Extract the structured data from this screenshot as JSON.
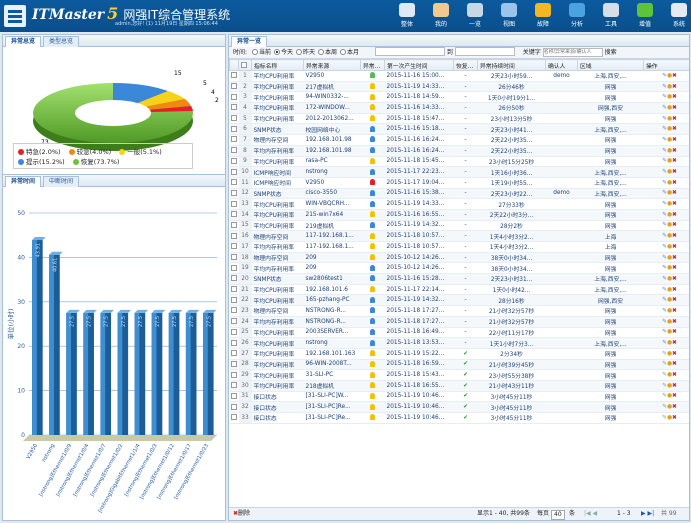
{
  "header": {
    "brand_en": "ITMaster",
    "brand_num": "5",
    "brand_cn": "网强IT综合管理系统",
    "user_line": "admin,您好! (1) 11月19日 星期四 15:06:44"
  },
  "nav": [
    {
      "label": "整体",
      "icon": "monitor-icon",
      "color": "#dfe9f4"
    },
    {
      "label": "我的",
      "icon": "user-icon",
      "color": "#f0c890"
    },
    {
      "label": "一览",
      "icon": "screen-icon",
      "color": "#c8d6e6"
    },
    {
      "label": "视图",
      "icon": "grid-icon",
      "color": "#9cc4ea"
    },
    {
      "label": "故障",
      "icon": "warning-icon",
      "color": "#f2b722"
    },
    {
      "label": "分析",
      "icon": "pie-icon",
      "color": "#4aa3e0"
    },
    {
      "label": "工具",
      "icon": "tools-icon",
      "color": "#d8dee6"
    },
    {
      "label": "增值",
      "icon": "plus-icon",
      "color": "#5cc33a"
    },
    {
      "label": "系统",
      "icon": "gear-icon",
      "color": "#e6eaf0"
    }
  ],
  "left_top": {
    "tabs": [
      "异常总览",
      "类型总览"
    ],
    "pie": {
      "labels": [
        "15",
        "5",
        "4",
        "2",
        "73"
      ],
      "legend": [
        {
          "label": "特急(2.0%)",
          "color": "#e3202a"
        },
        {
          "label": "较急(4.0%)",
          "color": "#ee8a12"
        },
        {
          "label": "一般(5.1%)",
          "color": "#f7d21a"
        },
        {
          "label": "提示(15.2%)",
          "color": "#3b87d9"
        },
        {
          "label": "恢复(73.7%)",
          "color": "#6ec13a"
        }
      ]
    }
  },
  "left_bottom": {
    "tabs": [
      "异常时间",
      "中断时间"
    ],
    "chart_data": {
      "type": "bar",
      "ylabel": "单位(小时)",
      "ylim": [
        0,
        50
      ],
      "yticks": [
        "50",
        "40",
        "30",
        "20",
        "10",
        "0"
      ],
      "categories": [
        "V2950",
        "nstrong",
        "[nstrong]Ethernet1/0/9",
        "[nstrong]Ethernet1/0/4",
        "[nstrong]Ethernet1/0/7",
        "[nstrong]Ethernet1/0/2",
        "[nstrong]GigabitEthernet1/1/4",
        "[nstrong]Ethernet1/0/3",
        "[nstrong]Ethernet1/0/12",
        "[nstrong]Ethernet1/0/17",
        "[nstrong]Ethernet1/0/23"
      ],
      "values": [
        43.91,
        40.61,
        27.5,
        27.5,
        27.5,
        27.5,
        27.5,
        27.5,
        27.5,
        27.5,
        27.5
      ],
      "value_labels": [
        "43.91",
        "40.61",
        "27.5",
        "27.5",
        "27.5",
        "27.5",
        "27.5",
        "27.5",
        "27.5",
        "27.5",
        "27.5"
      ]
    }
  },
  "right": {
    "tab": "异常一览",
    "toolbar": {
      "time_label": "时间:",
      "ranges": [
        "当前",
        "今天",
        "昨天",
        "本周",
        "本月"
      ],
      "selected": "今天",
      "calendar_label": "到",
      "keyword_label": "关键字",
      "keyword_placeholder": "名称/异常来源/确认人",
      "search_label": "搜索"
    },
    "columns": [
      "",
      "",
      "指标名称",
      "异常来源",
      "异常…",
      "第一次产生时间",
      "恢复…",
      "异常持续时间",
      "确认人",
      "区域",
      "操作"
    ],
    "rows": [
      [
        "平均CPU利用率",
        "V2950",
        "#5cb85c",
        "2015-11-16 15:00...",
        "-",
        "2天23小时59...",
        "demo",
        "上海,西安,...",
        "blue"
      ],
      [
        "平均CPU利用率",
        "217虚拟机",
        "#f2c200",
        "2015-11-19 14:33...",
        "-",
        "26分46秒",
        "",
        "网强",
        "blue"
      ],
      [
        "平均CPU利用率",
        "94-WIN0332-...",
        "#f2c200",
        "2015-11-18 14:59...",
        "-",
        "1天0小时19分1...",
        "",
        "网强",
        "blue"
      ],
      [
        "平均CPU利用率",
        "172-WINDOW...",
        "#f2c200",
        "2015-11-16 14:33...",
        "-",
        "26分50秒",
        "",
        "网强,西安",
        "blue"
      ],
      [
        "平均CPU利用率",
        "2012-2013062...",
        "#f2c200",
        "2015-11-18 15:47...",
        "-",
        "23小时13分5秒",
        "",
        "网强",
        "blue"
      ],
      [
        "SNMP状态",
        "校园网络中心",
        "#3b87d9",
        "2015-11-16 15:18...",
        "-",
        "2天23小时41...",
        "",
        "上海,西安,...",
        "blue"
      ],
      [
        "物理内存空间",
        "192.168.101.98",
        "#3b87d9",
        "2015-11-16 16:24...",
        "-",
        "2天22小时35...",
        "",
        "网强",
        "blue"
      ],
      [
        "平均内存利用率",
        "192.168.101.98",
        "#3b87d9",
        "2015-11-16 16:24...",
        "-",
        "2天22小时35...",
        "",
        "网强",
        "blue"
      ],
      [
        "平均CPU利用率",
        "rasa-PC",
        "#f2c200",
        "2015-11-18 15:45...",
        "-",
        "23小时15分25秒",
        "",
        "网强",
        "blue"
      ],
      [
        "ICMP响应时间",
        "nstrong",
        "#3b87d9",
        "2015-11-17 22:23...",
        "-",
        "1天16小时36...",
        "",
        "上海,西安,...",
        "blue"
      ],
      [
        "ICMP响应时间",
        "V2950",
        "#e3202a",
        "2015-11-17 19:04...",
        "-",
        "1天19小时55...",
        "",
        "上海,西安,...",
        "blue"
      ],
      [
        "SNMP状态",
        "cisco-3550",
        "#3b87d9",
        "2015-11-16 15:38...",
        "-",
        "2天23小时22...",
        "demo",
        "上海,西安,...",
        "blue"
      ],
      [
        "平均CPU利用率",
        "WIN-VBQCRH...",
        "#3b87d9",
        "2015-11-19 14:33...",
        "-",
        "27分33秒",
        "",
        "网强",
        "blue"
      ],
      [
        "平均CPU利用率",
        "215-win7x64",
        "#f2c200",
        "2015-11-16 16:55...",
        "-",
        "2天22小时3分...",
        "",
        "网强",
        "blue"
      ],
      [
        "平均CPU利用率",
        "219虚拟机",
        "#3b87d9",
        "2015-11-19 14:32...",
        "-",
        "28分2秒",
        "",
        "网强",
        "blue"
      ],
      [
        "物理内存空间",
        "117-192.168.1...",
        "#f2c200",
        "2015-11-18 10:57...",
        "-",
        "1天4小时3分2...",
        "",
        "上海",
        "blue"
      ],
      [
        "平均内存利用率",
        "117-192.168.1...",
        "#f2c200",
        "2015-11-18 10:57...",
        "-",
        "1天4小时3分2...",
        "",
        "上海",
        "blue"
      ],
      [
        "物理内存空间",
        "209",
        "#f2c200",
        "2015-10-12 14:26...",
        "-",
        "38天0小时34...",
        "",
        "网强",
        "blue"
      ],
      [
        "平均内存利用率",
        "209",
        "#3b87d9",
        "2015-10-12 14:26...",
        "-",
        "38天0小时34...",
        "",
        "网强",
        "blue"
      ],
      [
        "SNMP状态",
        "sw2806test1",
        "#3b87d9",
        "2015-11-16 15:28...",
        "-",
        "2天23小时31...",
        "",
        "上海,西安,...",
        "blue"
      ],
      [
        "平均CPU利用率",
        "192.168.101.6",
        "#f2c200",
        "2015-11-17 22:14...",
        "-",
        "1天0小时42...",
        "",
        "上海,西安,...",
        "blue"
      ],
      [
        "平均CPU利用率",
        "165-pzhang-PC",
        "#3b87d9",
        "2015-11-19 14:32...",
        "-",
        "28分16秒",
        "",
        "网强,西安",
        "blue"
      ],
      [
        "物理内存空间",
        "NSTRONG-R...",
        "#3b87d9",
        "2015-11-18 17:27...",
        "-",
        "21小时32分57秒",
        "",
        "网强",
        "blue"
      ],
      [
        "平均内存利用率",
        "NSTRONG-R...",
        "#3b87d9",
        "2015-11-18 17:27...",
        "-",
        "21小时32分57秒",
        "",
        "网强",
        "blue"
      ],
      [
        "平均CPU利用率",
        "2003SERVER...",
        "#3b87d9",
        "2015-11-18 16:49...",
        "-",
        "22小时11分17秒",
        "",
        "网强",
        "blue"
      ],
      [
        "平均CPU利用率",
        "nstrong",
        "#3b87d9",
        "2015-11-18 13:53...",
        "-",
        "1天1小时7分3...",
        "",
        "上海,西安,...",
        "blue"
      ],
      [
        "平均CPU利用率",
        "192.168.101.163",
        "#f2c200",
        "2015-11-19 15:22...",
        "✔",
        "2分34秒",
        "",
        "网强",
        "green"
      ],
      [
        "平均CPU利用率",
        "96-WIN-2008T...",
        "#f2c200",
        "2015-11-18 16:59...",
        "✔",
        "21小时39分45秒",
        "",
        "网强",
        "green"
      ],
      [
        "平均CPU利用率",
        "31-SLI-PC",
        "#f2c200",
        "2015-11-18 15:43...",
        "✔",
        "23小时55分38秒",
        "",
        "网强",
        "green"
      ],
      [
        "平均CPU利用率",
        "218虚拟机",
        "#f2c200",
        "2015-11-18 16:55...",
        "✔",
        "21小时43分11秒",
        "",
        "网强",
        "green"
      ],
      [
        "接口状态",
        "[31-SLI-PC]W...",
        "#f2c200",
        "2015-11-19 10:46...",
        "✔",
        "3小时45分11秒",
        "",
        "网强",
        "green"
      ],
      [
        "接口状态",
        "[31-SLI-PC]Re...",
        "#f2c200",
        "2015-11-19 10:46...",
        "✔",
        "3小时45分11秒",
        "",
        "网强",
        "green"
      ],
      [
        "接口状态",
        "[31-SLI-PC]Re...",
        "#f2c200",
        "2015-11-19 10:46...",
        "✔",
        "3小时45分11秒",
        "",
        "网强",
        "green"
      ]
    ],
    "footer": {
      "delete_label": "删除",
      "summary": "显示1 - 40, 共99条",
      "per_page_label": "每页",
      "per_page": "40",
      "unit": "条",
      "page_info": "1 - 3",
      "total_pages": "共 99"
    }
  }
}
